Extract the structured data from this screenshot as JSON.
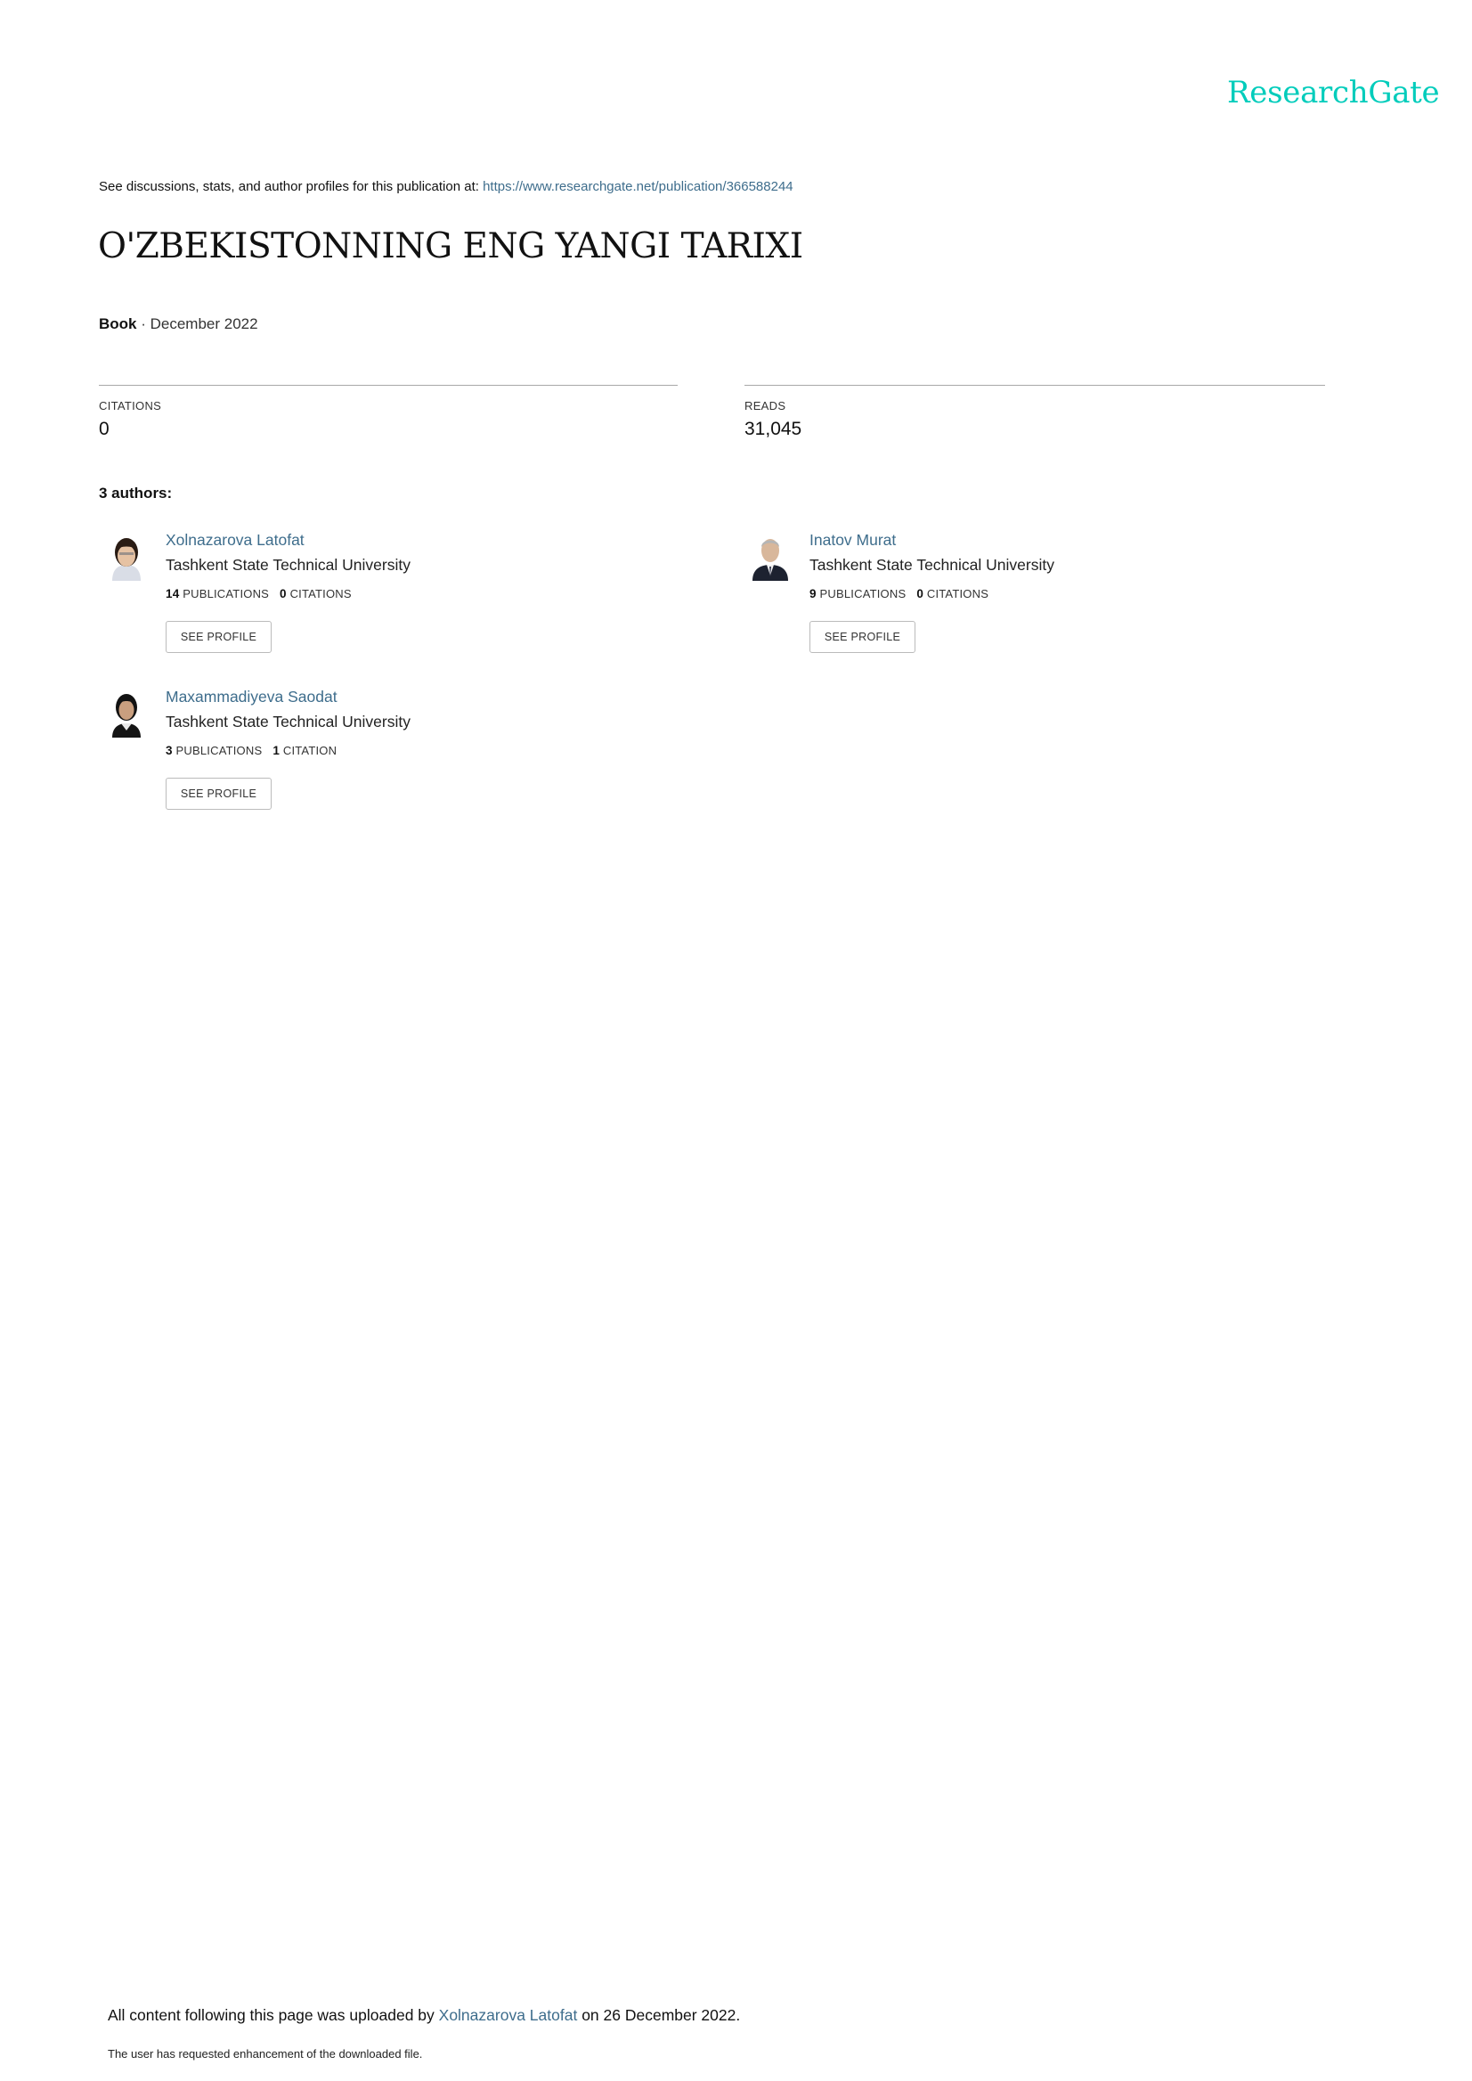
{
  "header": {
    "logo_text": "ResearchGate",
    "logo_color": "#00ccbb"
  },
  "intro": {
    "prefix": "See discussions, stats, and author profiles for this publication at:",
    "url": "https://www.researchgate.net/publication/366588244"
  },
  "publication": {
    "title": "O'ZBEKISTONNING ENG YANGI TARIXI",
    "type": "Book",
    "separator": " · ",
    "date": "December 2022"
  },
  "stats": {
    "citations_label": "CITATIONS",
    "citations_value": "0",
    "reads_label": "READS",
    "reads_value": "31,045"
  },
  "authors_heading": "3 authors:",
  "authors": [
    {
      "name": "Xolnazarova Latofat",
      "institution": "Tashkent State Technical University",
      "publications_count": "14",
      "publications_label": "PUBLICATIONS",
      "citations_count": "0",
      "citations_label": "CITATIONS",
      "button_label": "SEE PROFILE",
      "avatar_icon": "person-photo-icon"
    },
    {
      "name": "Inatov Murat",
      "institution": "Tashkent State Technical University",
      "publications_count": "9",
      "publications_label": "PUBLICATIONS",
      "citations_count": "0",
      "citations_label": "CITATIONS",
      "button_label": "SEE PROFILE",
      "avatar_icon": "person-photo-icon"
    },
    {
      "name": "Maxammadiyeva Saodat",
      "institution": "Tashkent State Technical University",
      "publications_count": "3",
      "publications_label": "PUBLICATIONS",
      "citations_count": "1",
      "citations_label": "CITATION",
      "button_label": "SEE PROFILE",
      "avatar_icon": "person-photo-icon"
    }
  ],
  "footer": {
    "upload_prefix": "All content following this page was uploaded by",
    "uploader": "Xolnazarova Latofat",
    "upload_suffix": "on 26 December 2022.",
    "note": "The user has requested enhancement of the downloaded file."
  },
  "colors": {
    "link": "#3e6d8c",
    "rule": "#a8a8a8",
    "button_border": "#bbbbbb"
  }
}
